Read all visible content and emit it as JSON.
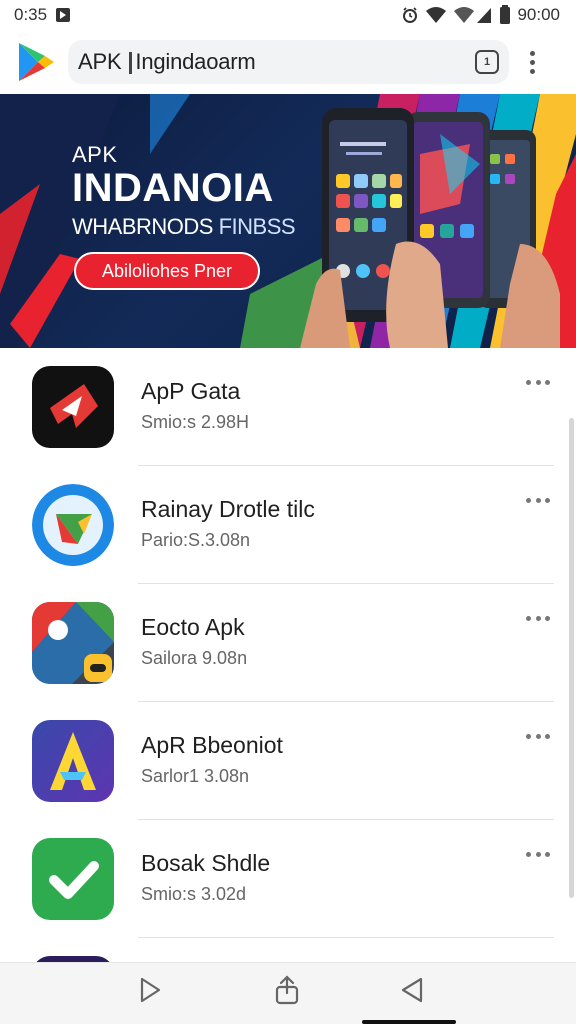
{
  "status_bar": {
    "time": "0:35",
    "clock_right": "90:00",
    "icons": [
      "notification-icon",
      "alarm-icon",
      "wifi-icon",
      "signal-icon",
      "battery-icon"
    ]
  },
  "browser": {
    "logo": "play-store-logo",
    "url_prefix": "APK",
    "url_text": "Ingindaoarm",
    "tab_count": "1"
  },
  "banner": {
    "kicker": "APK",
    "title": "INDANOIA",
    "subtitle_a": "WHABRNODS",
    "subtitle_b": "FINBSS",
    "cta_label": "Abiloliohes Pner",
    "colors": {
      "bg": "#0d1b3d",
      "cta": "#e8222e"
    }
  },
  "apps": [
    {
      "name": "ApP Gata",
      "meta": "Smio:s 2.98H",
      "icon": "app-icon-red-arrow"
    },
    {
      "name": "Rainay Drotle tilc",
      "meta": "Pario:S.3.08n",
      "icon": "app-icon-blue-chevron"
    },
    {
      "name": "Eocto Apk",
      "meta": "Sailora 9.08n",
      "icon": "app-icon-colorful-tiles"
    },
    {
      "name": "ApR Bbeoniot",
      "meta": "Sarlor1 3.08n",
      "icon": "app-icon-letter-a"
    },
    {
      "name": "Bosak Shdle",
      "meta": "Smio:s 3.02d",
      "icon": "app-icon-green-check"
    }
  ],
  "nav": {
    "buttons": [
      "play-icon",
      "share-icon",
      "back-icon"
    ]
  }
}
